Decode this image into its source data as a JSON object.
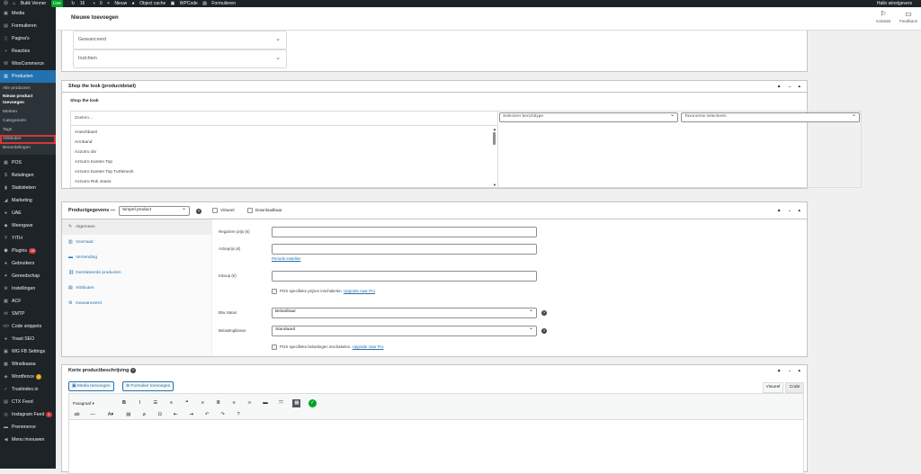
{
  "adminbar": {
    "site_name": "Butik Venner",
    "live_badge": "Live",
    "updates_count": "16",
    "comments_count": "0",
    "new_label": "Nieuw",
    "object_cache": "Object cache",
    "wpcode": "WPCode",
    "forms": "Formulieren",
    "greeting": "Hallo winstgevers"
  },
  "sidebar": {
    "items_top": [
      {
        "label": "Media",
        "icon": "media-icon"
      },
      {
        "label": "Formulieren",
        "icon": "forms-icon"
      },
      {
        "label": "Pagina's",
        "icon": "pages-icon"
      },
      {
        "label": "Reacties",
        "icon": "comments-icon"
      },
      {
        "label": "WooCommerce",
        "icon": "woocommerce-icon"
      },
      {
        "label": "Producten",
        "icon": "products-icon",
        "active": true
      }
    ],
    "submenu": [
      {
        "label": "Alle producten"
      },
      {
        "label": "Nieuw product"
      },
      {
        "label": "toevoegen"
      },
      {
        "label": "Merken"
      },
      {
        "label": "Categorieën"
      },
      {
        "label": "Tags"
      },
      {
        "label": "Attributen"
      },
      {
        "label": "Beoordelingen"
      }
    ],
    "items_bottom": [
      {
        "label": "POS",
        "icon": "pos-icon"
      },
      {
        "label": "Betalingen",
        "icon": "payments-icon"
      },
      {
        "label": "Statistieken",
        "icon": "stats-icon"
      },
      {
        "label": "Marketing",
        "icon": "marketing-icon"
      },
      {
        "label": "UAE",
        "icon": "uae-icon"
      },
      {
        "label": "Weergave",
        "icon": "appearance-icon"
      },
      {
        "label": "YITH",
        "icon": "yith-icon"
      },
      {
        "label": "Plugins",
        "icon": "plugins-icon",
        "badge": "15"
      },
      {
        "label": "Gebruikers",
        "icon": "users-icon"
      },
      {
        "label": "Gereedschap",
        "icon": "tools-icon"
      },
      {
        "label": "Instellingen",
        "icon": "settings-icon"
      },
      {
        "label": "ACF",
        "icon": "acf-icon"
      },
      {
        "label": "SMTP",
        "icon": "smtp-icon"
      },
      {
        "label": "Code snippets",
        "icon": "code-icon"
      },
      {
        "label": "Yoast SEO",
        "icon": "yoast-icon"
      },
      {
        "label": "WG FB Settings",
        "icon": "wg-icon"
      },
      {
        "label": "Winstkassa",
        "icon": "kassa-icon"
      },
      {
        "label": "Wordfence",
        "icon": "wordfence-icon",
        "badge": "2",
        "badge_yellow": true
      },
      {
        "label": "Trustindex.io",
        "icon": "trustindex-icon"
      },
      {
        "label": "CTX Feed",
        "icon": "ctx-icon"
      },
      {
        "label": "Instagram Feed",
        "icon": "instagram-icon",
        "badge": "1"
      },
      {
        "label": "Premmerce",
        "icon": "premmerce-icon"
      },
      {
        "label": "Menu invouwen",
        "icon": "collapse-icon"
      }
    ]
  },
  "topbar": {
    "page_title": "Nieuwe toevoegen",
    "activity": "Activiteit",
    "feedback": "Feedback"
  },
  "accordion": {
    "advanced": "Geavanceerd",
    "insights": "Inzichten"
  },
  "shop_look": {
    "box_title": "Shop the look (productdetail)",
    "inner_title": "Shop the look",
    "search_placeholder": "Zoeken...",
    "post_type_select": "Selecteer berichttype",
    "taxonomy_select": "Taxonomie selecteren",
    "list": [
      "Aneichbaeri",
      "Armband",
      "Azzurro div",
      "Azzurro Kanten Top",
      "Azzurro Kanten Top Turtleneck",
      "Azzurro Rok Jeans"
    ]
  },
  "product_data": {
    "title": "Productgegevens —",
    "type_select": "Simpel product",
    "virtual": "Virtueel",
    "downloadable": "Downloadbaar",
    "tabs": [
      {
        "label": "Algemeen",
        "icon": "wrench-icon",
        "active": true
      },
      {
        "label": "Voorraad",
        "icon": "inventory-icon"
      },
      {
        "label": "Verzending",
        "icon": "shipping-icon"
      },
      {
        "label": "Gerelateerde producten",
        "icon": "link-icon"
      },
      {
        "label": "Attributen",
        "icon": "attributes-icon"
      },
      {
        "label": "Geavanceerd",
        "icon": "gear-icon"
      }
    ],
    "regular_price_label": "Reguliere prijs (€)",
    "sale_price_label": "Actieprijs (€)",
    "schedule_link": "Periode instellen",
    "purchase_label": "Inkoop (€)",
    "pos_price_text": "POS specifieke prijzen inschakelen.",
    "upgrade_link": "Upgrade naar Pro",
    "tax_status_label": "Btw status",
    "tax_status_value": "Belastbaar",
    "tax_class_label": "Belastingklasse",
    "tax_class_value": "Standaard",
    "pos_tax_text": "POS specifieke belastingen inschakelen."
  },
  "short_desc": {
    "title": "Korte productbeschrijving",
    "add_media": "Media toevoegen",
    "add_form": "Formulier toevoegen",
    "tab_visual": "Visueel",
    "tab_code": "Code",
    "paragraph_select": "Paragraaf"
  }
}
